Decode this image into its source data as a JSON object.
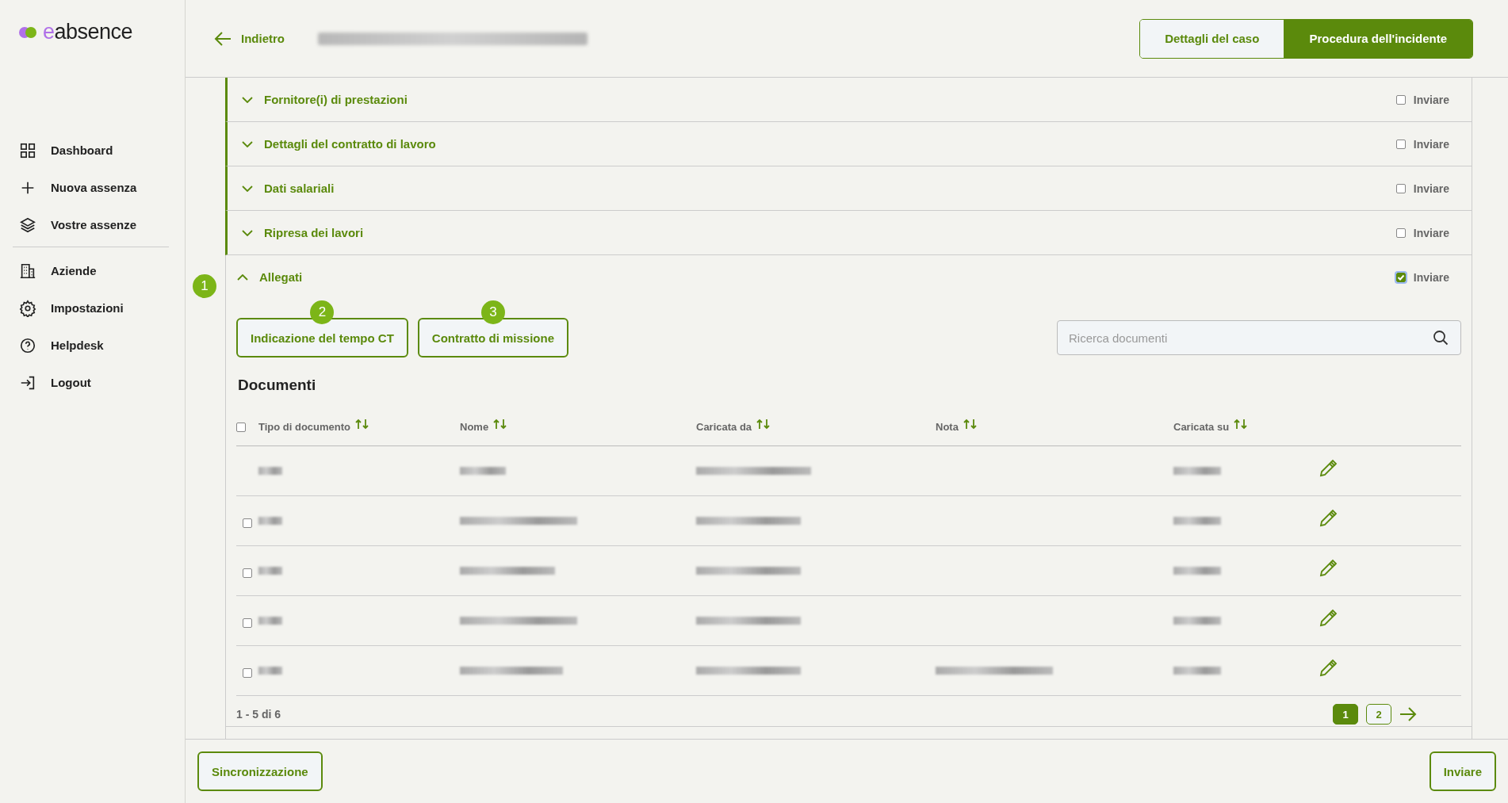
{
  "logo": {
    "accent": "e",
    "rest": "absence"
  },
  "nav_groups": [
    [
      {
        "label": "Dashboard"
      },
      {
        "label": "Nuova assenza"
      },
      {
        "label": "Vostre assenze"
      }
    ],
    [
      {
        "label": "Aziende"
      },
      {
        "label": "Impostazioni"
      },
      {
        "label": "Helpdesk"
      },
      {
        "label": "Logout"
      }
    ]
  ],
  "header": {
    "back": "Indietro",
    "tabs": [
      {
        "label": "Dettagli del caso",
        "selected": false
      },
      {
        "label": "Procedura dell'incidente",
        "selected": true
      }
    ]
  },
  "sections": [
    {
      "title": "Fornitore(i) di prestazioni",
      "expanded": false,
      "send_label": "Inviare",
      "checked": false
    },
    {
      "title": "Dettagli del contratto di lavoro",
      "expanded": false,
      "send_label": "Inviare",
      "checked": false
    },
    {
      "title": "Dati salariali",
      "expanded": false,
      "send_label": "Inviare",
      "checked": false
    },
    {
      "title": "Ripresa dei lavori",
      "expanded": false,
      "send_label": "Inviare",
      "checked": false
    },
    {
      "title": "Allegati",
      "expanded": true,
      "send_label": "Inviare",
      "checked": true
    }
  ],
  "markers": [
    "1",
    "2",
    "3"
  ],
  "attachments": {
    "buttons": [
      "Indicazione del tempo CT",
      "Contratto di missione"
    ],
    "search": {
      "placeholder": "Ricerca documenti"
    },
    "heading": "Documenti",
    "table": {
      "columns": [
        "Tipo di documento",
        "Nome",
        "Caricata da",
        "Nota",
        "Caricata su"
      ],
      "all_checked": false,
      "rows": [
        {
          "kind": "plain"
        },
        {
          "kind": "selectable",
          "checked": false
        },
        {
          "kind": "selectable",
          "checked": false
        },
        {
          "kind": "selectable",
          "checked": false
        },
        {
          "kind": "selectable",
          "checked": false
        }
      ]
    },
    "range": "1 - 5 di 6",
    "pages": [
      {
        "label": "1",
        "selected": true
      },
      {
        "label": "2",
        "selected": false
      }
    ]
  },
  "footer": {
    "sync": "Sincronizzazione",
    "send": "Inviare"
  }
}
